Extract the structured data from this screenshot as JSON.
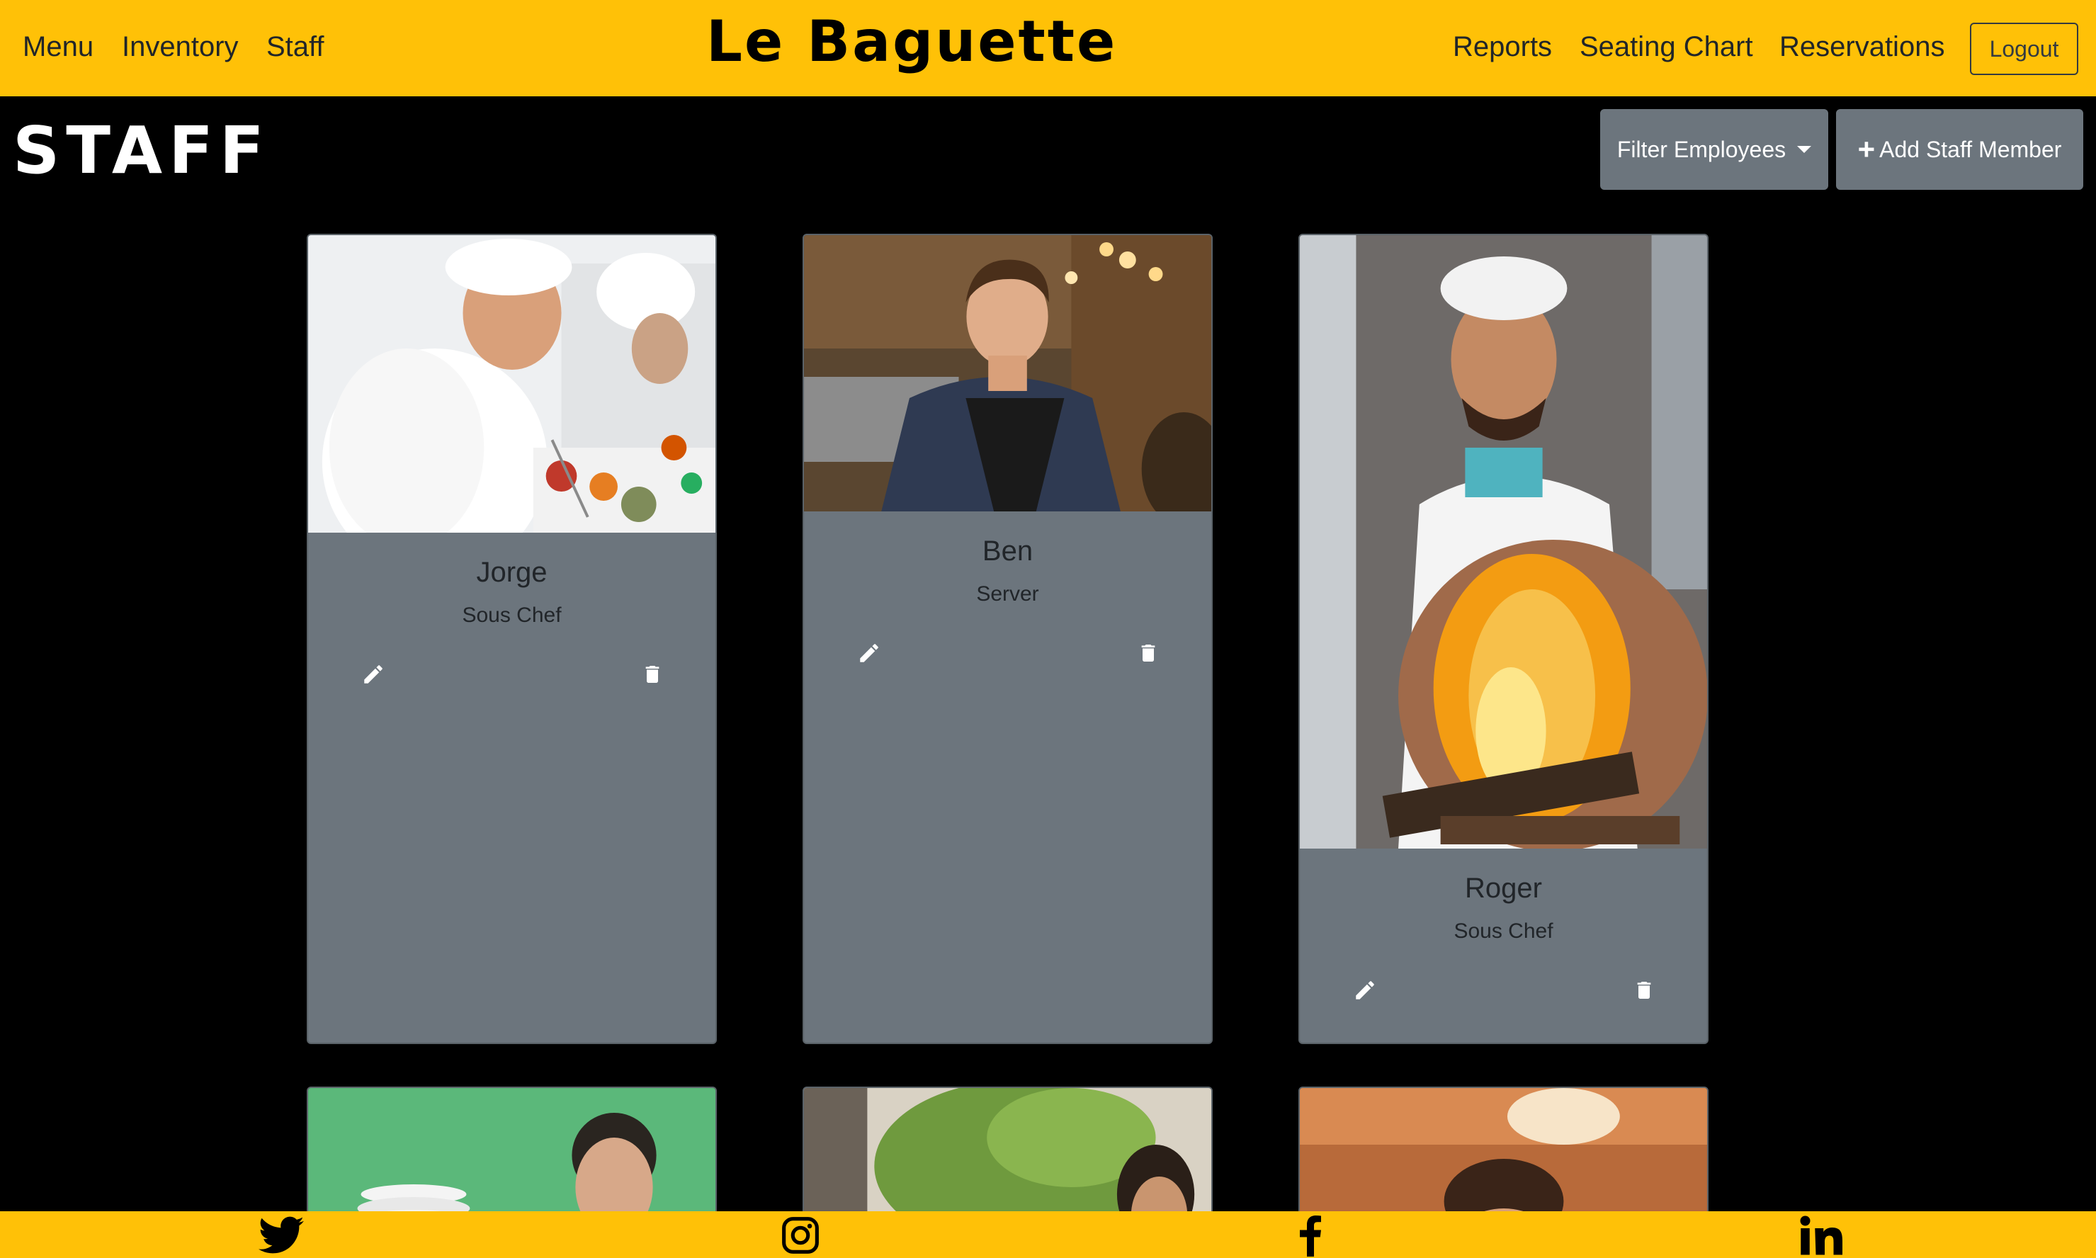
{
  "brand": {
    "name": "Le Baguette"
  },
  "nav": {
    "left": [
      "Menu",
      "Inventory",
      "Staff"
    ],
    "right": [
      "Reports",
      "Seating Chart",
      "Reservations"
    ],
    "logout": "Logout"
  },
  "page": {
    "title": "STAFF",
    "filter_label": "Filter Employees",
    "add_label": "Add Staff Member"
  },
  "staff": [
    {
      "name": "Jorge",
      "role": "Sous Chef"
    },
    {
      "name": "Ben",
      "role": "Server"
    },
    {
      "name": "Roger",
      "role": "Sous Chef"
    }
  ],
  "icons": {
    "edit": "pencil-icon",
    "delete": "trash-icon",
    "social": [
      "twitter-icon",
      "instagram-icon",
      "facebook-icon",
      "linkedin-icon"
    ]
  },
  "colors": {
    "accent": "#ffc107",
    "card": "#6c757d",
    "background": "#000000"
  }
}
